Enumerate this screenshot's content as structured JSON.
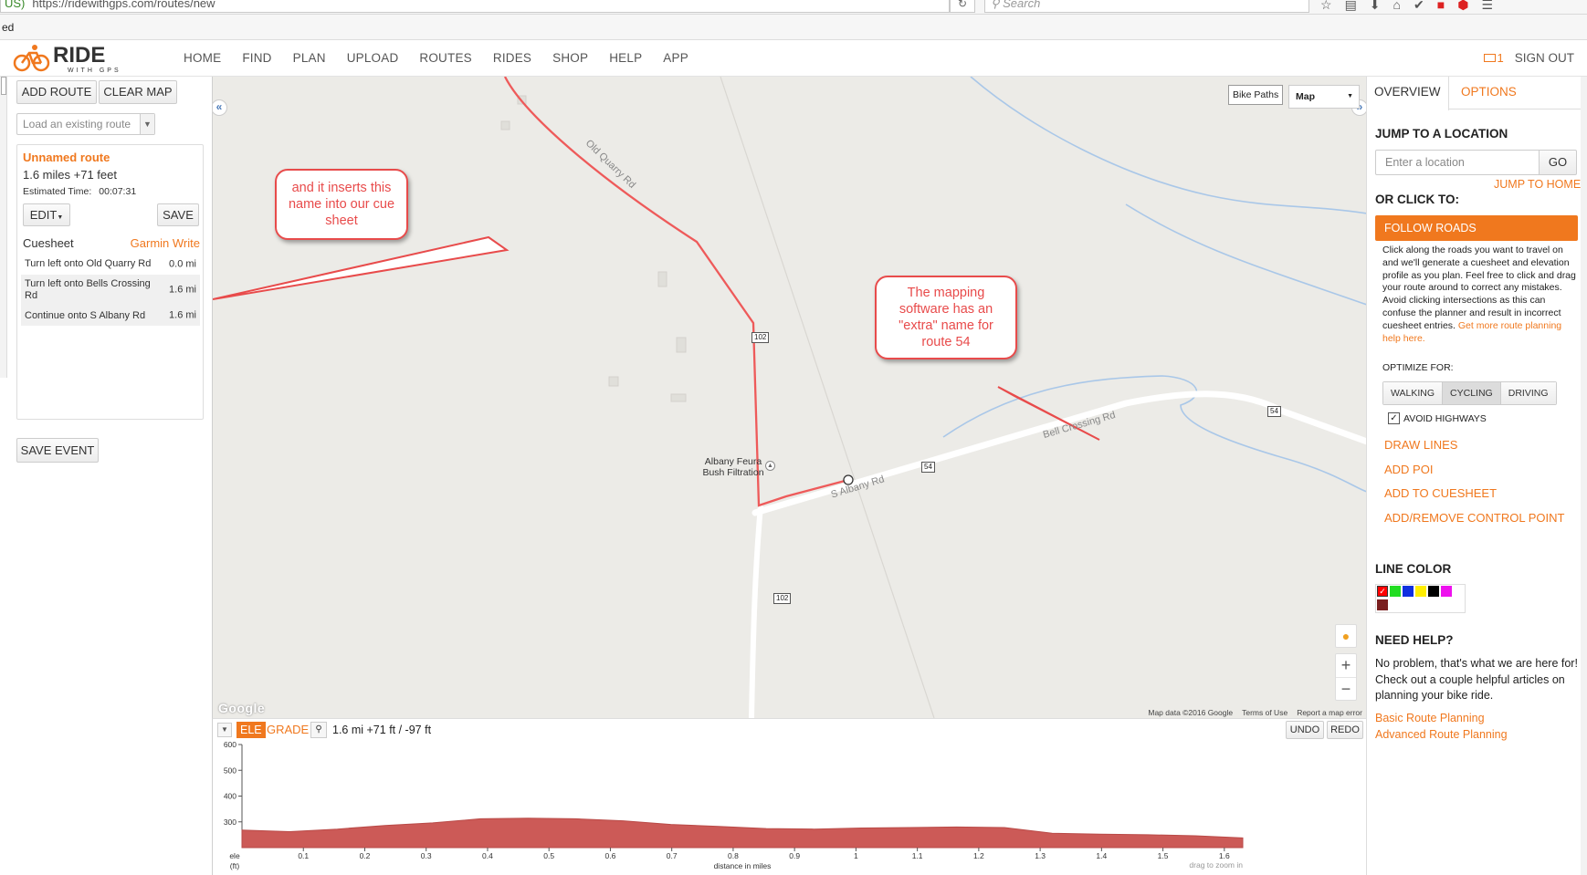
{
  "browser": {
    "url_prefix": "US)",
    "url": "https://ridewithgps.com/routes/new",
    "search_placeholder": "Search",
    "bookmark_text": "ed"
  },
  "header": {
    "logo_main": "RIDE",
    "logo_sub": "WITH GPS",
    "nav": [
      "HOME",
      "FIND",
      "PLAN",
      "UPLOAD",
      "ROUTES",
      "RIDES",
      "SHOP",
      "HELP",
      "APP"
    ],
    "mail_count": "1",
    "sign_out": "SIGN OUT"
  },
  "left": {
    "add_route": "ADD ROUTE",
    "clear_map": "CLEAR MAP",
    "load_placeholder": "Load an existing route",
    "route_name": "Unnamed route",
    "route_stats": "1.6 miles  +71 feet",
    "est_label": "Estimated Time:",
    "est_value": "00:07:31",
    "edit": "EDIT",
    "save": "SAVE",
    "cuesheet": "Cuesheet",
    "garmin": "Garmin Write",
    "cues": [
      {
        "text": "Turn left onto Old Quarry Rd",
        "dist": "0.0 mi"
      },
      {
        "text": "Turn left onto Bells Crossing Rd",
        "dist": "1.6 mi"
      },
      {
        "text": "Continue onto S Albany Rd",
        "dist": "1.6 mi"
      }
    ],
    "save_event": "SAVE EVENT"
  },
  "map": {
    "bike_paths": "Bike Paths",
    "map_type": "Map",
    "road_old_quarry": "Old Quarry Rd",
    "road_bell_crossing": "Bell Crossing Rd",
    "road_s_albany": "S Albany Rd",
    "shield_102": "102",
    "shield_54": "54",
    "poi": "Albany Feura\nBush Filtration",
    "google": "Google",
    "map_data": "Map data ©2016 Google",
    "terms": "Terms of Use",
    "report": "Report a map error",
    "callout_1": "and it inserts this name into our cue sheet",
    "callout_2": "The mapping software has an \"extra\" name for route 54"
  },
  "elevation": {
    "tab_ele": "ELE",
    "tab_grade": "GRADE",
    "stats": "1.6 mi +71 ft / -97 ft",
    "undo": "UNDO",
    "redo": "REDO",
    "y_ticks": [
      "600",
      "500",
      "400",
      "300"
    ],
    "x_ticks": [
      "0.1",
      "0.2",
      "0.3",
      "0.4",
      "0.5",
      "0.6",
      "0.7",
      "0.8",
      "0.9",
      "1",
      "1.1",
      "1.2",
      "1.3",
      "1.4",
      "1.5",
      "1.6"
    ],
    "y_label_1": "ele",
    "y_label_2": "(ft)",
    "x_label": "distance in miles",
    "drag_hint": "drag to zoom in",
    "profile_ft": [
      268,
      262,
      272,
      286,
      296,
      312,
      314,
      312,
      304,
      290,
      282,
      274,
      272,
      276,
      278,
      280,
      278,
      256,
      252,
      250,
      246,
      238
    ]
  },
  "right": {
    "tab_overview": "OVERVIEW",
    "tab_options": "OPTIONS",
    "jump_heading": "JUMP TO A LOCATION",
    "location_placeholder": "Enter a location",
    "go": "GO",
    "jump_home": "JUMP TO HOME",
    "or_click": "OR CLICK TO:",
    "follow_roads": "FOLLOW ROADS",
    "follow_desc": "Click along the roads you want to travel on and we'll generate a cuesheet and elevation profile as you plan. Feel free to click and drag your route around to correct any mistakes. Avoid clicking intersections as this can confuse the planner and result in incorrect cuesheet entries.",
    "follow_link": "Get more route planning help here.",
    "optimize_label": "OPTIMIZE FOR:",
    "optimize": [
      "WALKING",
      "CYCLING",
      "DRIVING"
    ],
    "avoid_highways": "AVOID HIGHWAYS",
    "draw_lines": "DRAW LINES",
    "add_poi": "ADD POI",
    "add_cuesheet": "ADD TO CUESHEET",
    "add_remove_cp": "ADD/REMOVE CONTROL POINT",
    "line_color": "LINE COLOR",
    "colors": [
      "#ff0000",
      "#22dd22",
      "#1030e0",
      "#ffee00",
      "#000000",
      "#ee11ee",
      "#7a1f1f"
    ],
    "need_help": "NEED HELP?",
    "help_text": "No problem, that's what we are here for! Check out a couple helpful articles on planning your bike ride.",
    "link_basic": "Basic Route Planning",
    "link_advanced": "Advanced Route Planning"
  }
}
